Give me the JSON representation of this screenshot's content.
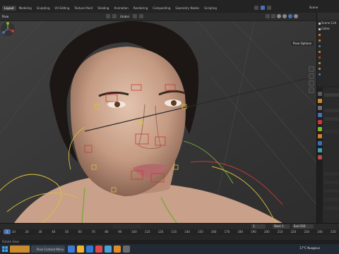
{
  "workspace_tabs": [
    "Layout",
    "Modeling",
    "Sculpting",
    "UV Editing",
    "Texture Paint",
    "Shading",
    "Animation",
    "Rendering",
    "Compositing",
    "Geometry Nodes",
    "Scripting"
  ],
  "active_tab": "Layout",
  "scene_label": "Scene",
  "viewport": {
    "mode_label": "Pose",
    "orientation_label": "Global",
    "pose_options_label": "Pose Options"
  },
  "outliner": {
    "rows": [
      "Scene Coll",
      "Collec",
      "",
      "",
      "",
      "",
      "",
      "",
      "",
      ""
    ]
  },
  "timeline": {
    "current_frame": "1",
    "start_label": "Start",
    "start_value": "1",
    "end_label": "End",
    "end_value": "250",
    "ticks": [
      "0",
      "10",
      "20",
      "30",
      "40",
      "50",
      "60",
      "70",
      "80",
      "90",
      "100",
      "110",
      "120",
      "130",
      "140",
      "150",
      "160",
      "170",
      "180",
      "190",
      "200",
      "210",
      "220",
      "230",
      "240",
      "250"
    ]
  },
  "status_bar": {
    "left_text": "Rotate View"
  },
  "taskbar": {
    "search_placeholder": "Pose Context Menu",
    "weather": "17°C  Nuageux"
  },
  "colors": {
    "accent_blue": "#4772b3",
    "rig_yellow": "#d8c23a",
    "rig_red": "#c8393b",
    "rig_green": "#7fb82c"
  }
}
